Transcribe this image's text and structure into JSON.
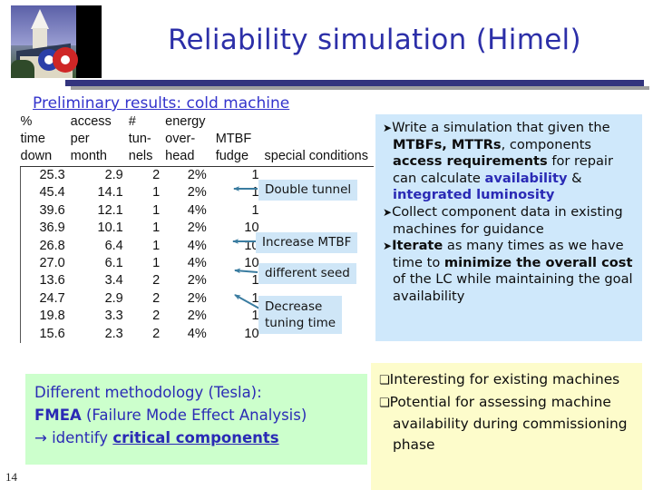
{
  "slide": {
    "title": "Reliability simulation (Himel)",
    "number": "14",
    "logo_icon": "church-photo-logo"
  },
  "table_section": {
    "heading": "Preliminary results: cold machine",
    "columns": [
      {
        "line1": "%",
        "line2": "time",
        "line3": "down"
      },
      {
        "line1": "access",
        "line2": "per",
        "line3": "month"
      },
      {
        "line1": "#",
        "line2": "tun-",
        "line3": "nels"
      },
      {
        "line1": "energy",
        "line2": "over-",
        "line3": "head"
      },
      {
        "line1": "",
        "line2": "MTBF",
        "line3": "fudge"
      },
      {
        "line1": "",
        "line2": "",
        "line3": "special conditions"
      }
    ],
    "rows": [
      {
        "time_down": "25.3",
        "access_per_month": "2.9",
        "tunnels": "2",
        "energy_overhead": "2%",
        "mtbf_fudge": "1"
      },
      {
        "time_down": "45.4",
        "access_per_month": "14.1",
        "tunnels": "1",
        "energy_overhead": "2%",
        "mtbf_fudge": "1"
      },
      {
        "time_down": "39.6",
        "access_per_month": "12.1",
        "tunnels": "1",
        "energy_overhead": "4%",
        "mtbf_fudge": "1"
      },
      {
        "time_down": "36.9",
        "access_per_month": "10.1",
        "tunnels": "1",
        "energy_overhead": "2%",
        "mtbf_fudge": "10"
      },
      {
        "time_down": "26.8",
        "access_per_month": "6.4",
        "tunnels": "1",
        "energy_overhead": "4%",
        "mtbf_fudge": "10"
      },
      {
        "time_down": "27.0",
        "access_per_month": "6.1",
        "tunnels": "1",
        "energy_overhead": "4%",
        "mtbf_fudge": "10"
      },
      {
        "time_down": "13.6",
        "access_per_month": "3.4",
        "tunnels": "2",
        "energy_overhead": "2%",
        "mtbf_fudge": "1"
      },
      {
        "time_down": "24.7",
        "access_per_month": "2.9",
        "tunnels": "2",
        "energy_overhead": "2%",
        "mtbf_fudge": "1"
      },
      {
        "time_down": "19.8",
        "access_per_month": "3.3",
        "tunnels": "2",
        "energy_overhead": "2%",
        "mtbf_fudge": "1"
      },
      {
        "time_down": "15.6",
        "access_per_month": "2.3",
        "tunnels": "2",
        "energy_overhead": "4%",
        "mtbf_fudge": "10"
      }
    ],
    "callouts": [
      {
        "label": "Double tunnel",
        "target_row": 1
      },
      {
        "label": "Increase MTBF",
        "target_row": 4
      },
      {
        "label": "different seed",
        "target_row": 6
      },
      {
        "label": "Decrease\ntuning time",
        "target_row": 7
      }
    ],
    "callout_color": "#cfe6f7",
    "arrow_color": "#3a7ca0"
  },
  "blue_panel": {
    "background": "#cfe8fb",
    "bullet_glyph": "➤",
    "items": [
      {
        "parts": [
          {
            "text": "Write a simulation that given the ",
            "style": "normal"
          },
          {
            "text": "MTBFs, MTTRs",
            "style": "bold"
          },
          {
            "text": ", components ",
            "style": "normal"
          },
          {
            "text": "access requirements",
            "style": "bold"
          },
          {
            "text": " for repair can calculate ",
            "style": "normal"
          },
          {
            "text": "availability",
            "style": "accent"
          },
          {
            "text": " & ",
            "style": "normal"
          },
          {
            "text": "integrated luminosity",
            "style": "accent"
          }
        ]
      },
      {
        "parts": [
          {
            "text": "Collect component data in existing machines for guidance",
            "style": "normal"
          }
        ]
      },
      {
        "parts": [
          {
            "text": "Iterate",
            "style": "bold"
          },
          {
            "text": " as many times as we have time to ",
            "style": "normal"
          },
          {
            "text": "minimize the overall cost",
            "style": "bold"
          },
          {
            "text": " of the LC while maintaining the goal availability",
            "style": "normal"
          }
        ]
      }
    ]
  },
  "green_panel": {
    "background": "#ccffcc",
    "line1": "Different methodology (Tesla):",
    "line2_bold": "FMEA",
    "line2_rest": " (Failure Mode Effect Analysis)",
    "line3_arrow": "→",
    "line3_text": " identify ",
    "line3_underlined": "critical components"
  },
  "yellow_panel": {
    "background": "#fdfccb",
    "bullet_glyph": "❏",
    "items": [
      "Interesting for existing machines",
      "Potential for assessing machine availability during commissioning phase"
    ]
  }
}
